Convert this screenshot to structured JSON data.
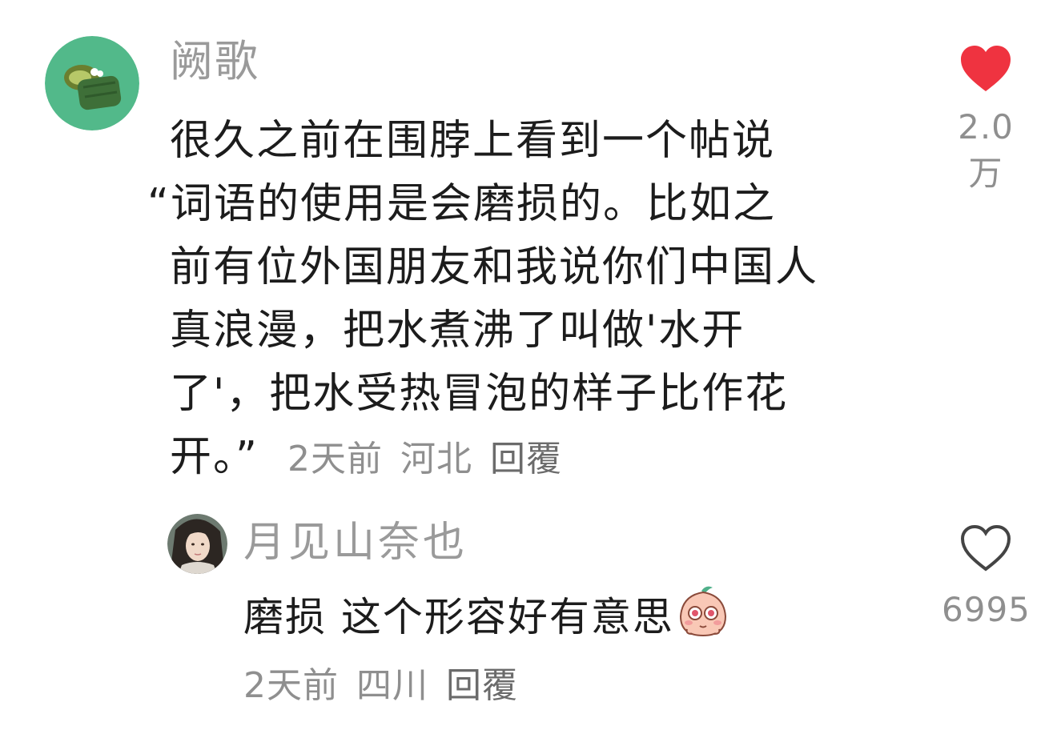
{
  "comment": {
    "username": "阙歌",
    "lines": [
      "很久之前在围脖上看到一个帖说",
      "“词语的使用是会磨损的。比如之",
      "前有位外国朋友和我说你们中国人",
      "真浪漫，把水煮沸了叫做'水开",
      "了'，把水受热冒泡的样子比作花",
      "开。”"
    ],
    "time": "2天前",
    "location": "河北",
    "reply_label": "回覆",
    "like_count": "2.0万",
    "liked": true,
    "like_color": "#ef3340"
  },
  "reply": {
    "username": "月见山奈也",
    "text": "磨损 这个形容好有意思",
    "emoji": "peach-eyes-emoji",
    "time": "2天前",
    "location": "四川",
    "reply_label": "回覆",
    "like_count": "6995",
    "liked": false
  }
}
